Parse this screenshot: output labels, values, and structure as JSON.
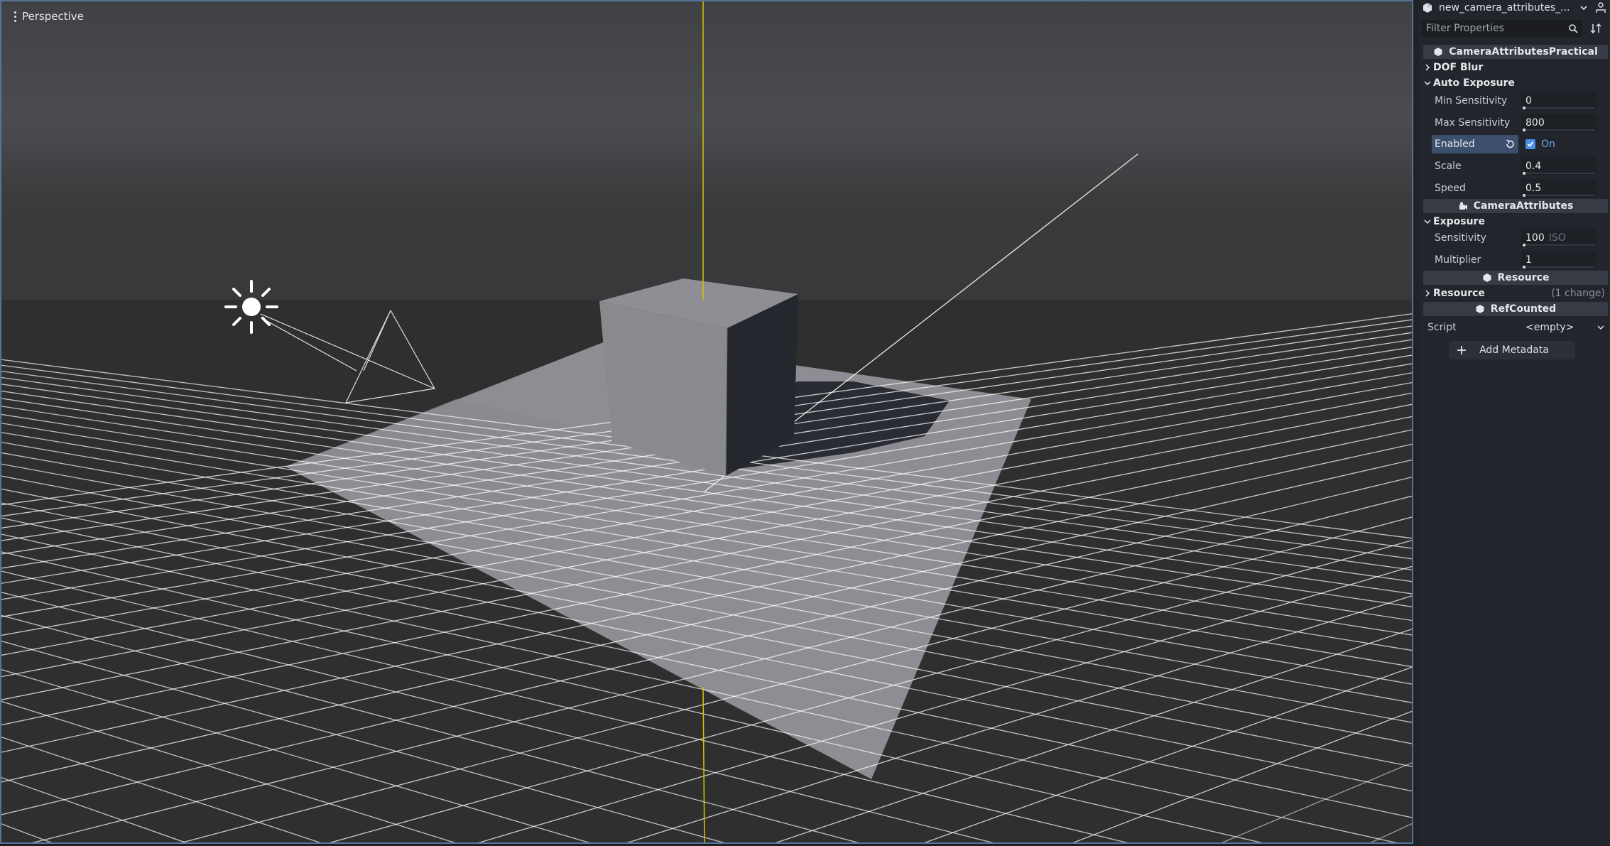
{
  "viewport": {
    "mode_label": "Perspective"
  },
  "inspector": {
    "resource_name": "new_camera_attributes_...",
    "filter_placeholder": "Filter Properties",
    "categories": {
      "practical": "CameraAttributesPractical",
      "camera_attributes": "CameraAttributes",
      "resource": "Resource",
      "refcounted": "RefCounted"
    },
    "sections": {
      "dof_blur": "DOF Blur",
      "auto_exposure": "Auto Exposure",
      "exposure": "Exposure",
      "resource": "Resource",
      "resource_changes": "(1 change)"
    },
    "auto_exposure": {
      "min_sensitivity": {
        "label": "Min Sensitivity",
        "value": "0"
      },
      "max_sensitivity": {
        "label": "Max Sensitivity",
        "value": "800"
      },
      "enabled": {
        "label": "Enabled",
        "value": "On"
      },
      "scale": {
        "label": "Scale",
        "value": "0.4"
      },
      "speed": {
        "label": "Speed",
        "value": "0.5"
      }
    },
    "exposure": {
      "sensitivity": {
        "label": "Sensitivity",
        "value": "100",
        "suffix": "ISO"
      },
      "multiplier": {
        "label": "Multiplier",
        "value": "1"
      }
    },
    "script": {
      "label": "Script",
      "value": "<empty>"
    },
    "add_metadata": "Add Metadata"
  },
  "colors": {
    "accent": "#4c8ee6",
    "viewport_border": "#57739a",
    "y_axis": "#d8c400",
    "grid": "#ffffff",
    "floor": "#8e8d93"
  }
}
